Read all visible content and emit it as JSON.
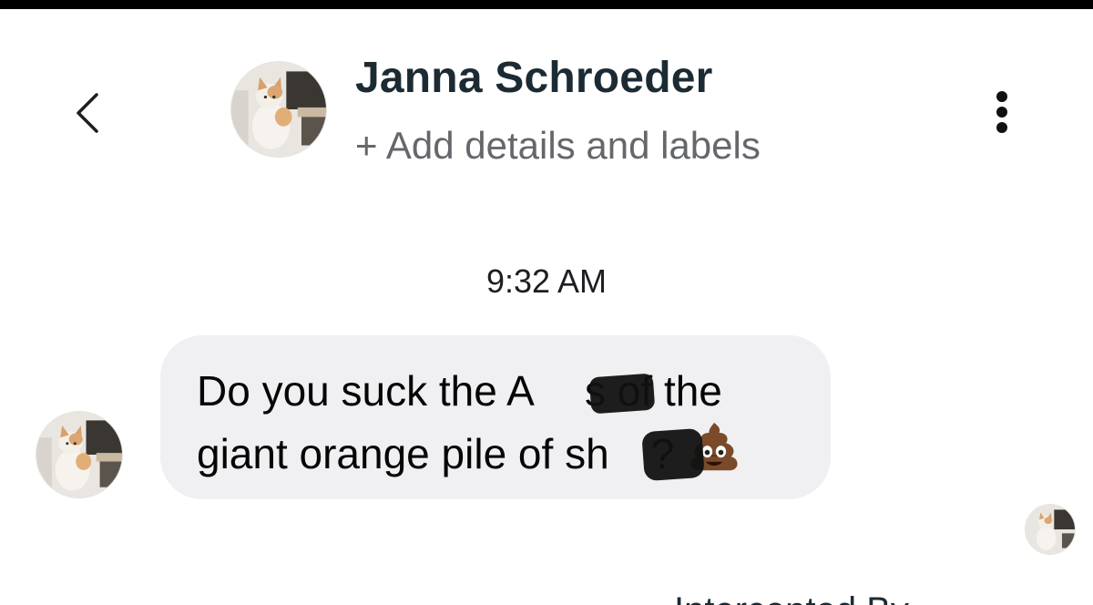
{
  "header": {
    "contact_name": "Janna Schroeder",
    "add_details": "+ Add details and labels",
    "back_icon": "chevron-left-icon",
    "more_icon": "vertical-ellipsis-icon"
  },
  "conversation": {
    "timestamp": "9:32 AM",
    "messages": [
      {
        "sender": "Janna Schroeder",
        "line1": "Do you suck the A      s of the",
        "line2": "giant orange pile of sh     ?",
        "emoji": "pile-of-poo-icon"
      }
    ],
    "cutoff_text": "Intercepted By"
  },
  "colors": {
    "name": "#1c2b33",
    "secondary": "#65676b",
    "bubble": "#f0f0f2",
    "topbar": "#000000"
  }
}
